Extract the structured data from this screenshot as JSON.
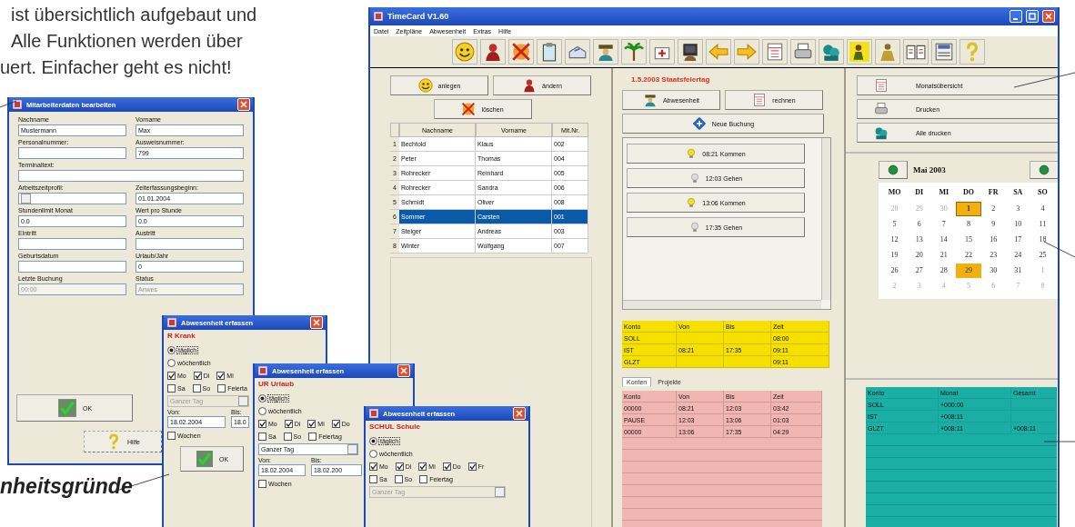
{
  "intro_text": [
    "ist übersichtlich aufgebaut und",
    "Alle Funktionen werden über",
    "uert. Einfacher geht es nicht!"
  ],
  "main_window": {
    "title": "TimeCard V1.60",
    "menu": [
      "Datei",
      "Zeitpläne",
      "Abwesenheit",
      "Extras",
      "Hilfe"
    ],
    "employee_buttons": [
      "anlegen",
      "ändern",
      "löschen"
    ],
    "employee_table": {
      "columns": [
        "Nachname",
        "Vorname",
        "Mit.Nr."
      ],
      "rows": [
        {
          "no": "1",
          "last": "Bechtold",
          "first": "Klaus",
          "id": "002",
          "selected": false
        },
        {
          "no": "2",
          "last": "Peter",
          "first": "Thomas",
          "id": "004",
          "selected": false
        },
        {
          "no": "3",
          "last": "Rohrecker",
          "first": "Reinhard",
          "id": "005",
          "selected": false
        },
        {
          "no": "4",
          "last": "Rohrecker",
          "first": "Sandra",
          "id": "006",
          "selected": false
        },
        {
          "no": "5",
          "last": "Schmidt",
          "first": "Oliver",
          "id": "008",
          "selected": false
        },
        {
          "no": "6",
          "last": "Sommer",
          "first": "Carsten",
          "id": "001",
          "selected": true
        },
        {
          "no": "7",
          "last": "Steiger",
          "first": "Andreas",
          "id": "003",
          "selected": false
        },
        {
          "no": "8",
          "last": "Winter",
          "first": "Wolfgang",
          "id": "007",
          "selected": false
        }
      ]
    },
    "date_heading": "1.5.2003 Staatsfeiertag",
    "booking_buttons": [
      "Abwesenheit",
      "rechnen",
      "Neue Buchung"
    ],
    "bookings": [
      {
        "label": "08:21 Kommen",
        "kind": "in"
      },
      {
        "label": "12:03 Gehen",
        "kind": "out"
      },
      {
        "label": "13:06 Kommen",
        "kind": "in"
      },
      {
        "label": "17:35 Gehen",
        "kind": "out"
      }
    ],
    "summary_table": {
      "columns": [
        "Konto",
        "Von",
        "Bis",
        "Zeit"
      ],
      "rows": [
        {
          "account": "SOLL",
          "time": "08:00"
        },
        {
          "account": "IST",
          "from": "08:21",
          "to": "17:35",
          "time": "09:11"
        },
        {
          "account": "GLZT",
          "time": "09:11"
        }
      ]
    },
    "tabs": [
      {
        "label": "Konten",
        "selected": true
      },
      {
        "label": "Projekte",
        "selected": false
      }
    ],
    "accounts_table": {
      "columns": [
        "Konto",
        "Von",
        "Bis",
        "Zeit"
      ],
      "rows": [
        {
          "account": "00000",
          "from": "08:21",
          "to": "12:03",
          "time": "03:42"
        },
        {
          "account": "PAUSE",
          "from": "12:03",
          "to": "13:06",
          "time": "01:03"
        },
        {
          "account": "00000",
          "from": "13:06",
          "to": "17:35",
          "time": "04:29"
        }
      ]
    },
    "report_buttons": [
      "Monatsübersicht",
      "Drucken",
      "Alle drucken"
    ],
    "calendar": {
      "month": "Mai 2003",
      "weekdays": [
        "MO",
        "DI",
        "MI",
        "DO",
        "FR",
        "SA",
        "SO"
      ],
      "days": [
        {
          "day": "28",
          "other_month": true,
          "holiday": false,
          "selected": false
        },
        {
          "day": "29",
          "other_month": true,
          "holiday": false,
          "selected": false
        },
        {
          "day": "30",
          "other_month": true,
          "holiday": false,
          "selected": false
        },
        {
          "day": "1",
          "other_month": false,
          "holiday": true,
          "selected": true
        },
        {
          "day": "2",
          "other_month": false,
          "holiday": false,
          "selected": false
        },
        {
          "day": "3",
          "other_month": false,
          "holiday": false,
          "selected": false
        },
        {
          "day": "4",
          "other_month": false,
          "holiday": false,
          "selected": false
        },
        {
          "day": "5",
          "other_month": false,
          "holiday": false,
          "selected": false
        },
        {
          "day": "6",
          "other_month": false,
          "holiday": false,
          "selected": false
        },
        {
          "day": "7",
          "other_month": false,
          "holiday": false,
          "selected": false
        },
        {
          "day": "8",
          "other_month": false,
          "holiday": false,
          "selected": false
        },
        {
          "day": "9",
          "other_month": false,
          "holiday": false,
          "selected": false
        },
        {
          "day": "10",
          "other_month": false,
          "holiday": false,
          "selected": false
        },
        {
          "day": "11",
          "other_month": false,
          "holiday": false,
          "selected": false
        },
        {
          "day": "12",
          "other_month": false,
          "holiday": false,
          "selected": false
        },
        {
          "day": "13",
          "other_month": false,
          "holiday": false,
          "selected": false
        },
        {
          "day": "14",
          "other_month": false,
          "holiday": false,
          "selected": false
        },
        {
          "day": "15",
          "other_month": false,
          "holiday": false,
          "selected": false
        },
        {
          "day": "16",
          "other_month": false,
          "holiday": false,
          "selected": false
        },
        {
          "day": "17",
          "other_month": false,
          "holiday": false,
          "selected": false
        },
        {
          "day": "18",
          "other_month": false,
          "holiday": false,
          "selected": false
        },
        {
          "day": "19",
          "other_month": false,
          "holiday": false,
          "selected": false
        },
        {
          "day": "20",
          "other_month": false,
          "holiday": false,
          "selected": false
        },
        {
          "day": "21",
          "other_month": false,
          "holiday": false,
          "selected": false
        },
        {
          "day": "22",
          "other_month": false,
          "holiday": false,
          "selected": false
        },
        {
          "day": "23",
          "other_month": false,
          "holiday": false,
          "selected": false
        },
        {
          "day": "24",
          "other_month": false,
          "holiday": false,
          "selected": false
        },
        {
          "day": "25",
          "other_month": false,
          "holiday": false,
          "selected": false
        },
        {
          "day": "26",
          "other_month": false,
          "holiday": false,
          "selected": false
        },
        {
          "day": "27",
          "other_month": false,
          "holiday": false,
          "selected": false
        },
        {
          "day": "28",
          "other_month": false,
          "holiday": false,
          "selected": false
        },
        {
          "day": "29",
          "other_month": false,
          "holiday": true,
          "selected": false
        },
        {
          "day": "30",
          "other_month": false,
          "holiday": false,
          "selected": false
        },
        {
          "day": "31",
          "other_month": false,
          "holiday": false,
          "selected": false
        },
        {
          "day": "1",
          "other_month": true,
          "holiday": false,
          "selected": false
        },
        {
          "day": "2",
          "other_month": true,
          "holiday": false,
          "selected": false
        },
        {
          "day": "3",
          "other_month": true,
          "holiday": false,
          "selected": false
        },
        {
          "day": "4",
          "other_month": true,
          "holiday": false,
          "selected": false
        },
        {
          "day": "5",
          "other_month": true,
          "holiday": false,
          "selected": false
        },
        {
          "day": "6",
          "other_month": true,
          "holiday": false,
          "selected": false
        },
        {
          "day": "7",
          "other_month": true,
          "holiday": false,
          "selected": false
        },
        {
          "day": "8",
          "other_month": true,
          "holiday": false,
          "selected": false
        }
      ]
    },
    "totals_table": {
      "columns": [
        "Konto",
        "Monat",
        "Gesamt"
      ],
      "rows": [
        {
          "account": "SOLL",
          "month": "+000:00"
        },
        {
          "account": "IST",
          "month": "+008:11"
        },
        {
          "account": "GLZT",
          "month": "+008:11",
          "total": "+008:11"
        }
      ]
    }
  },
  "employee_dialog": {
    "title": "Mitarbeiterdaten bearbeiten",
    "fields": [
      {
        "label": "Nachname",
        "value": "Mustermann",
        "kind": "text"
      },
      {
        "label": "Vorname",
        "value": "Max",
        "kind": "text"
      },
      {
        "label": "Personalnummer:",
        "kind": "text"
      },
      {
        "label": "Ausweisnummer:",
        "value": "799",
        "kind": "text"
      },
      {
        "label": "Terminaltext:",
        "kind": "wide"
      },
      {
        "label": "Arbeitszeitprofil:",
        "kind": "dropdown"
      },
      {
        "label": "Zeiterfassungsbeginn:",
        "value": "01.01.2004",
        "kind": "text"
      },
      {
        "label": "Stundenlimit Monat",
        "value": "0.0",
        "kind": "text"
      },
      {
        "label": "Wert pro Stunde",
        "value": "0.0",
        "kind": "text"
      },
      {
        "label": "Eintritt",
        "kind": "text"
      },
      {
        "label": "Austritt",
        "kind": "text"
      },
      {
        "label": "Geburtsdatum",
        "kind": "text"
      },
      {
        "label": "Urlaub/Jahr",
        "value": "0",
        "kind": "text"
      },
      {
        "label": "Letzte Buchung",
        "value": "00:00",
        "kind": "readonly"
      },
      {
        "label": "Status",
        "value": "Anwes",
        "kind": "readonly"
      }
    ],
    "ok_button": "OK",
    "help_button": "Hilfe"
  },
  "absence_dialogs": [
    {
      "title": "Abwesenheit erfassen",
      "code": "R Krank",
      "recurrence": [
        {
          "label": "täglich",
          "selected": true
        },
        {
          "label": "wöchentlich",
          "selected": false
        }
      ],
      "weekdays": [
        {
          "label": "Mo",
          "checked": true
        },
        {
          "label": "Di",
          "checked": true
        },
        {
          "label": "Mi",
          "checked": true
        }
      ],
      "other_days": [
        {
          "label": "Sa",
          "checked": false
        },
        {
          "label": "So",
          "checked": false
        },
        {
          "label": "Feierta",
          "checked": false
        }
      ],
      "duration": {
        "value": "Ganzer Tag",
        "disabled": true
      },
      "from_label": "Von:",
      "from_value": "18.02.2004",
      "to_label": "Bis:",
      "to_value": "18.0",
      "weeks": {
        "label": "Wochen",
        "checked": false
      },
      "ok_button": "OK"
    },
    {
      "title": "Abwesenheit erfassen",
      "code": "UR Urlaub",
      "recurrence": [
        {
          "label": "täglich",
          "selected": true
        },
        {
          "label": "wöchentlich",
          "selected": false
        }
      ],
      "weekdays": [
        {
          "label": "Mo",
          "checked": true
        },
        {
          "label": "Di",
          "checked": true
        },
        {
          "label": "Mi",
          "checked": true
        },
        {
          "label": "Do",
          "checked": true
        }
      ],
      "other_days": [
        {
          "label": "Sa",
          "checked": false
        },
        {
          "label": "So",
          "checked": false
        },
        {
          "label": "Feiertag",
          "checked": false
        }
      ],
      "duration": {
        "value": "Ganzer Tag",
        "disabled": false
      },
      "from_label": "Von:",
      "from_value": "18.02.2004",
      "to_label": "Bis:",
      "to_value": "18.02.200",
      "weeks": {
        "label": "Wochen",
        "checked": false
      }
    },
    {
      "title": "Abwesenheit erfassen",
      "code": "SCHUL Schule",
      "recurrence": [
        {
          "label": "täglich",
          "selected": true
        },
        {
          "label": "wöchentlich",
          "selected": false
        }
      ],
      "weekdays": [
        {
          "label": "Mo",
          "checked": true
        },
        {
          "label": "Di",
          "checked": true
        },
        {
          "label": "Mi",
          "checked": true
        },
        {
          "label": "Do",
          "checked": true
        },
        {
          "label": "Fr",
          "checked": true
        }
      ],
      "other_days": [
        {
          "label": "Sa",
          "checked": false
        },
        {
          "label": "So",
          "checked": false
        },
        {
          "label": "Feiertag",
          "checked": false
        }
      ],
      "duration": {
        "value": "Ganzer Tag",
        "disabled": true
      }
    }
  ],
  "caption": "nheitsgründe"
}
